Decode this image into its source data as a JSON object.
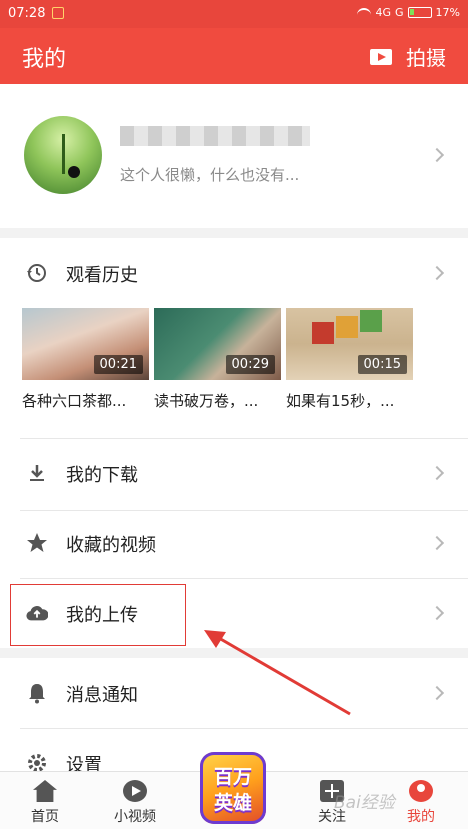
{
  "status_bar": {
    "time": "07:28",
    "network": "4G",
    "network2": "G",
    "battery": "17%"
  },
  "app_bar": {
    "title": "我的",
    "action_label": "拍摄"
  },
  "profile": {
    "bio": "这个人很懒，什么也没有..."
  },
  "history": {
    "label": "观看历史",
    "videos": [
      {
        "duration": "00:21",
        "caption": "各种六口茶都..."
      },
      {
        "duration": "00:29",
        "caption": "读书破万卷，..."
      },
      {
        "duration": "00:15",
        "caption": "如果有15秒，..."
      }
    ]
  },
  "menu": {
    "download": "我的下载",
    "favorites": "收藏的视频",
    "upload": "我的上传",
    "notifications": "消息通知",
    "settings": "设置"
  },
  "bottom_nav": {
    "tabs": [
      {
        "label": "首页"
      },
      {
        "label": "小视频"
      },
      {
        "label": "关注"
      },
      {
        "label": "我的"
      }
    ],
    "promo_line1": "百万",
    "promo_line2": "英雄"
  },
  "colors": {
    "accent": "#f04b3f",
    "active_tab": "#e8463c"
  }
}
